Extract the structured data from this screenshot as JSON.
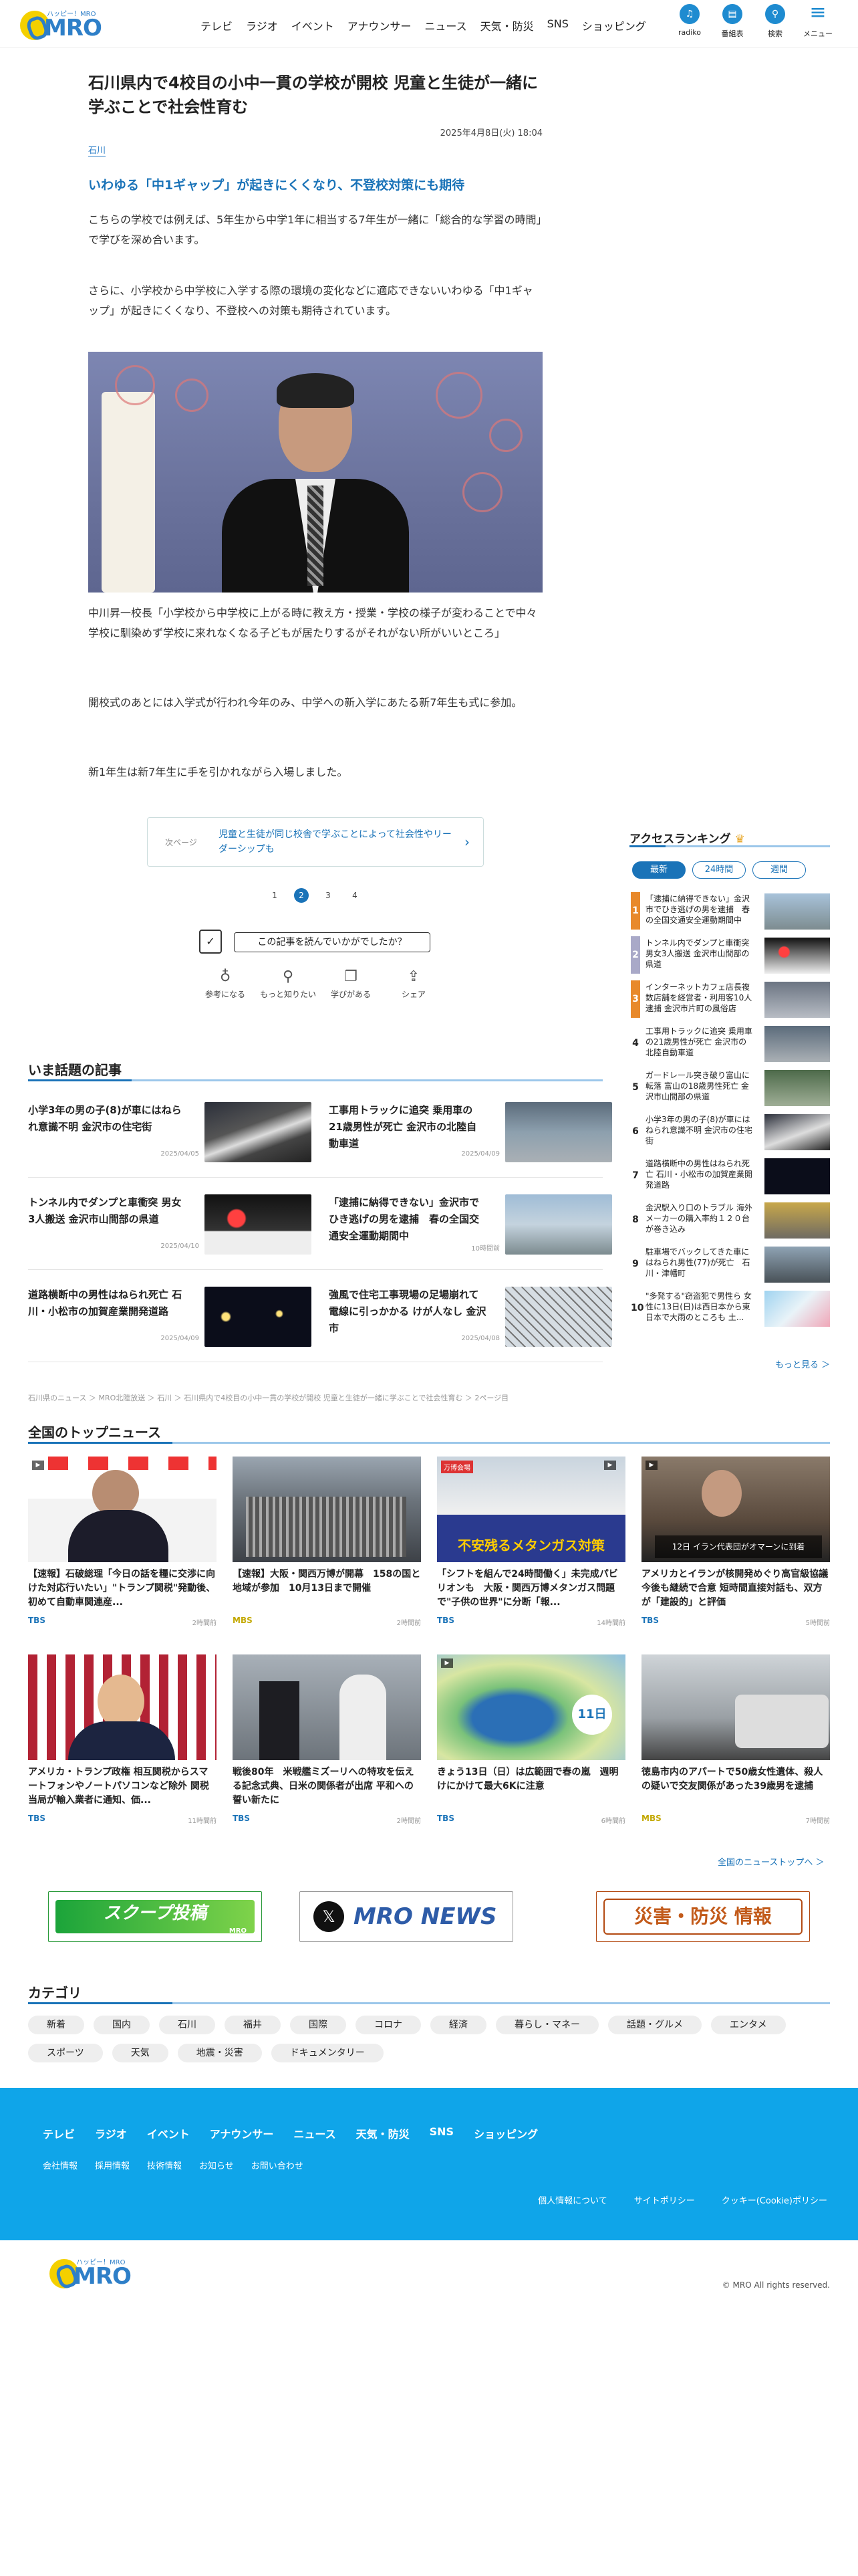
{
  "header": {
    "logo_tagline": "ハッピー！MRO",
    "logo_text": "MRO",
    "nav": [
      "テレビ",
      "ラジオ",
      "イベント",
      "アナウンサー",
      "ニュース",
      "天気・防災",
      "SNS",
      "ショッピング"
    ],
    "icons": [
      {
        "label": "radiko",
        "icon": "radiko-icon",
        "glyph": "♫"
      },
      {
        "label": "番組表",
        "icon": "program-guide-icon",
        "glyph": "▤"
      },
      {
        "label": "検索",
        "icon": "search-icon",
        "glyph": "⚲"
      },
      {
        "label": "メニュー",
        "icon": "menu-icon",
        "glyph": "≡"
      }
    ]
  },
  "article": {
    "title": "石川県内で4校目の小中一貫の学校が開校 児童と生徒が一緒に学ぶことで社会性育む",
    "date": "2025年4月8日(火) 18:04",
    "category": "石川",
    "heading": "いわゆる「中1ギャップ」が起きにくくなり、不登校対策にも期待",
    "p1": "こちらの学校では例えば、5年生から中学1年に相当する7年生が一緒に「総合的な学習の時間」で学びを深め合います。",
    "p2": "さらに、小学校から中学校に入学する際の環境の変化などに適応できないいわゆる「中1ギャップ」が起きにくくなり、不登校への対策も期待されています。",
    "caption": "中川昇一校長「小学校から中学校に上がる時に教え方・授業・学校の様子が変わることで中々学校に馴染めず学校に来れなくなる子どもが居たりするがそれがない所がいいところ」",
    "p3": "開校式のあとには入学式が行われ今年のみ、中学への新入学にあたる新7年生も式に参加。",
    "p4": "新1年生は新7年生に手を引かれながら入場しました。",
    "next_label": "次ページ",
    "next_title": "児童と生徒が同じ校舎で学ぶことによって社会性やリーダーシップも",
    "pages": [
      "1",
      "2",
      "3",
      "4"
    ],
    "current_page": "2",
    "survey_label": "この記事を読んでいかがでしたか？",
    "reactions": [
      {
        "label": "参考になる",
        "icon": "lightbulb-icon",
        "glyph": "♁"
      },
      {
        "label": "もっと知りたい",
        "icon": "magnifier-icon",
        "glyph": "⚲"
      },
      {
        "label": "学びがある",
        "icon": "book-icon",
        "glyph": "❐"
      },
      {
        "label": "シェア",
        "icon": "share-icon",
        "glyph": "⇪"
      }
    ]
  },
  "hot": {
    "heading": "いま話題の記事",
    "items": [
      {
        "title": "小学3年の男の子(8)が車にはねられ意識不明 金沢市の住宅街",
        "date": "2025/04/05"
      },
      {
        "title": "工事用トラックに追突 乗用車の21歳男性が死亡 金沢市の北陸自動車道",
        "date": "2025/04/09"
      },
      {
        "title": "トンネル内でダンプと車衝突 男女3人搬送 金沢市山間部の県道",
        "date": "2025/04/10"
      },
      {
        "title": "「逮捕に納得できない」金沢市でひき逃げの男を逮捕　春の全国交通安全運動期間中",
        "date": "10時間前"
      },
      {
        "title": "道路横断中の男性はねられ死亡 石川・小松市の加賀産業開発道路",
        "date": "2025/04/09"
      },
      {
        "title": "強風で住宅工事現場の足場崩れて電線に引っかかる けが人なし 金沢市",
        "date": "2025/04/08"
      }
    ]
  },
  "breadcrumb": "石川県のニュース ＞ MRO北陸放送 ＞ 石川 ＞ 石川県内で4校目の小中一貫の学校が開校 児童と生徒が一緒に学ぶことで社会性育む ＞ 2ページ目",
  "ranking": {
    "heading": "アクセスランキング",
    "tabs": [
      "最新",
      "24時間",
      "週間"
    ],
    "items": [
      {
        "n": "1",
        "title": "「逮捕に納得できない」金沢市でひき逃げの男を逮捕　春の全国交通安全運動期間中"
      },
      {
        "n": "2",
        "title": "トンネル内でダンプと車衝突 男女3人搬送 金沢市山間部の県道"
      },
      {
        "n": "3",
        "title": "インターネットカフェ店長複数店舗を経営者・利用客10人逮捕 金沢市片町の風俗店"
      },
      {
        "n": "4",
        "title": "工事用トラックに追突 乗用車の21歳男性が死亡 金沢市の北陸自動車道"
      },
      {
        "n": "5",
        "title": "ガードレール突き破り富山に転落 富山の18歳男性死亡 金沢市山間部の県道"
      },
      {
        "n": "6",
        "title": "小学3年の男の子(8)が車にはねられ意識不明 金沢市の住宅街"
      },
      {
        "n": "7",
        "title": "道路横断中の男性はねられ死亡 石川・小松市の加賀産業開発道路"
      },
      {
        "n": "8",
        "title": "金沢駅入り口のトラブル 海外メーカーの購入率約１２０台が巻き込み"
      },
      {
        "n": "9",
        "title": "駐車場でバックしてきた車にはねられ男性(77)が死亡　石川・津幡町"
      },
      {
        "n": "10",
        "title": "\"多発する\"窃盗犯で男性ら 女性に13日(日)は西日本から東日本で大雨のところも 土..."
      }
    ],
    "more": "もっと見る ＞"
  },
  "national": {
    "heading": "全国のトップニュース",
    "items": [
      {
        "title": "【速報】石破総理「今日の話を糧に交渉に向けた対応行いたい」\"トランプ関税\"発動後、初めて自動車関連産...",
        "src": "TBS",
        "time": "2時間前"
      },
      {
        "title": "【速報】大阪・関西万博が開幕　158の国と地域が参加　10月13日まで開催",
        "src": "MBS",
        "time": "2時間前"
      },
      {
        "title": "「シフトを組んで24時間働く」未完成パビリオンも　大阪・関西万博メタンガス問題で\"子供の世界\"に分断「報...",
        "src": "TBS",
        "time": "14時間前"
      },
      {
        "title": "アメリカとイランが核開発めぐり高官級協議 今後も継続で合意 短時間直接対話も、双方が「建設的」と評価",
        "src": "TBS",
        "time": "5時間前"
      },
      {
        "title": "アメリカ・トランプ政権 相互関税からスマートフォンやノートパソコンなど除外 関税当局が輸入業者に通知、価...",
        "src": "TBS",
        "time": "11時間前"
      },
      {
        "title": "戦後80年　米戦艦ミズーリへの特攻を伝える記念式典、日米の関係者が出席 平和への誓い新たに",
        "src": "TBS",
        "time": "2時間前"
      },
      {
        "title": "きょう13日（日）は広範囲で春の嵐　週明けにかけて最大6Kに注意",
        "src": "TBS",
        "time": "6時間前"
      },
      {
        "title": "徳島市内のアパートで50歳女性遺体、殺人の疑いで交友関係があった39歳男を逮捕",
        "src": "MBS",
        "time": "7時間前"
      }
    ],
    "more": "全国のニューストップへ ＞",
    "img_texts": {
      "gas": "不安残るメタンガス対策",
      "gas_top": "万博会場",
      "iran": "12日 イラン代表団がオマーンに到着",
      "weather": "11日"
    }
  },
  "banners": [
    {
      "text": "スクープ投稿",
      "sub": "MRO",
      "icon": "scoop-banner"
    },
    {
      "text": "MRO NEWS",
      "icon": "x-icon"
    },
    {
      "text": "災害・防災 情報",
      "icon": "disaster-banner"
    }
  ],
  "category": {
    "heading": "カテゴリ",
    "items": [
      "新着",
      "国内",
      "石川",
      "福井",
      "国際",
      "コロナ",
      "経済",
      "暮らし・マネー",
      "話題・グルメ",
      "エンタメ",
      "スポーツ",
      "天気",
      "地震・災害",
      "ドキュメンタリー"
    ]
  },
  "footer": {
    "nav": [
      "テレビ",
      "ラジオ",
      "イベント",
      "アナウンサー",
      "ニュース",
      "天気・防災",
      "SNS",
      "ショッピング"
    ],
    "nav2": [
      "会社情報",
      "採用情報",
      "技術情報",
      "お知らせ",
      "お問い合わせ"
    ],
    "nav3": [
      "個人情報について",
      "サイトポリシー",
      "クッキー(Cookie)ポリシー"
    ],
    "copyright": "© MRO All rights reserved."
  },
  "colors": {
    "accent": "#1a73b8",
    "footer": "#0fa5e9",
    "logo_yellow": "#f4d000",
    "rank_orange": "#e8892b"
  }
}
